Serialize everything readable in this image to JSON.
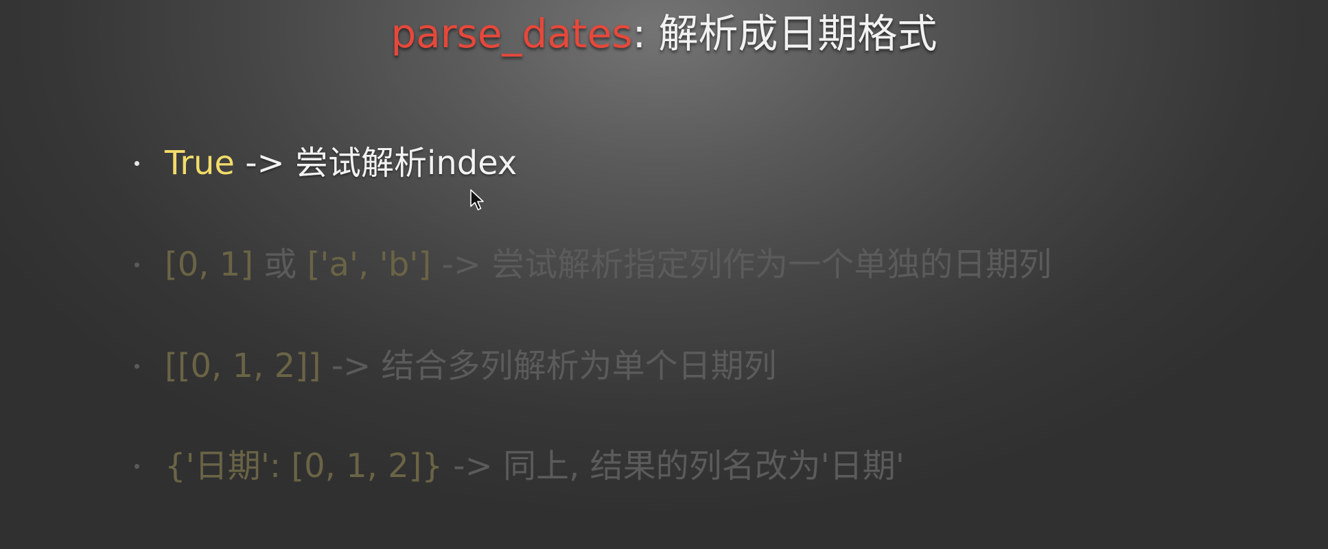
{
  "slide": {
    "title": {
      "code": "parse_dates",
      "rest": ": 解析成日期格式"
    },
    "bullets": [
      {
        "keyword": "True",
        "text": " -> 尝试解析index",
        "state": "active"
      },
      {
        "keyword": "[0, 1]",
        "middle": " 或 ",
        "keyword2": "['a', 'b']",
        "text": " -> 尝试解析指定列作为一个单独的日期列",
        "state": "dimmed"
      },
      {
        "keyword": "[[0, 1, 2]]",
        "text": " -> 结合多列解析为单个日期列",
        "state": "dimmed"
      },
      {
        "keyword": "{'日期': [0, 1, 2]}",
        "text": " -> 同上, 结果的列名改为'日期'",
        "state": "dimmed"
      }
    ]
  },
  "colors": {
    "title_code": "#e6483b",
    "active_keyword": "#f2dc6a",
    "active_text": "#f2f2f2",
    "dimmed_keyword": "#6a6446",
    "dimmed_text": "#5b5b5b"
  },
  "icons": {
    "cursor": "mouse-pointer-icon"
  }
}
